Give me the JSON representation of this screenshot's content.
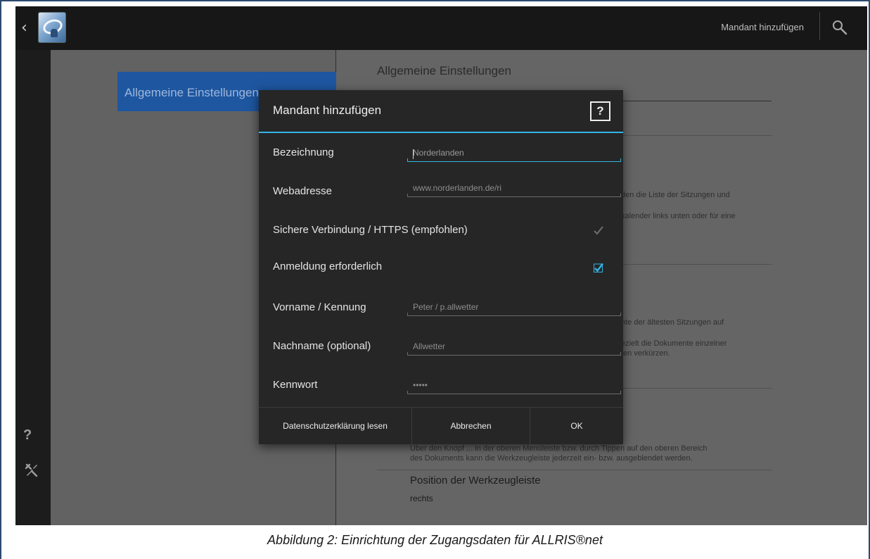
{
  "topbar": {
    "title": "Mandant hinzufügen"
  },
  "nav": {
    "selected_label": "Allgemeine Einstellungen"
  },
  "settings": {
    "header": "Allgemeine Einstellungen",
    "fragments": [
      "den die Liste der Sitzungen und",
      "kalender links unten oder für eine",
      "nte der ältesten Sitzungen auf",
      "ezielt die Dokumente einzelner",
      "ten verkürzen.",
      "Über den Knopf ... in der oberen Menüleiste bzw. durch Tippen auf den oberen Bereich",
      "des Dokuments kann die Werkzeugleiste jederzeit ein- bzw. ausgeblendet werden."
    ],
    "toolbar_position_title": "Position der Werkzeugleiste",
    "toolbar_position_value": "rechts"
  },
  "dialog": {
    "title": "Mandant hinzufügen",
    "help_label": "?",
    "fields": {
      "name_label": "Bezeichnung",
      "name_placeholder": "Norderlanden",
      "url_label": "Webadresse",
      "url_placeholder": "www.norderlanden.de/ri",
      "https_label": "Sichere Verbindung / HTTPS (empfohlen)",
      "https_checked": true,
      "login_label": "Anmeldung erforderlich",
      "login_checked": true,
      "user_label": "Vorname / Kennung",
      "user_placeholder": "Peter / p.allwetter",
      "lastname_label": "Nachname (optional)",
      "lastname_placeholder": "Allwetter",
      "password_label": "Kennwort",
      "password_value": "•••••"
    },
    "buttons": {
      "privacy": "Datenschutzerklärung lesen",
      "cancel": "Abbrechen",
      "ok": "OK"
    }
  },
  "sidebar": {
    "help_label": "?"
  },
  "caption": "Abbildung 2: Einrichtung der Zugangsdaten für ALLRIS®net",
  "colors": {
    "accent": "#33b5e5",
    "selected_nav": "#1e56a0"
  }
}
